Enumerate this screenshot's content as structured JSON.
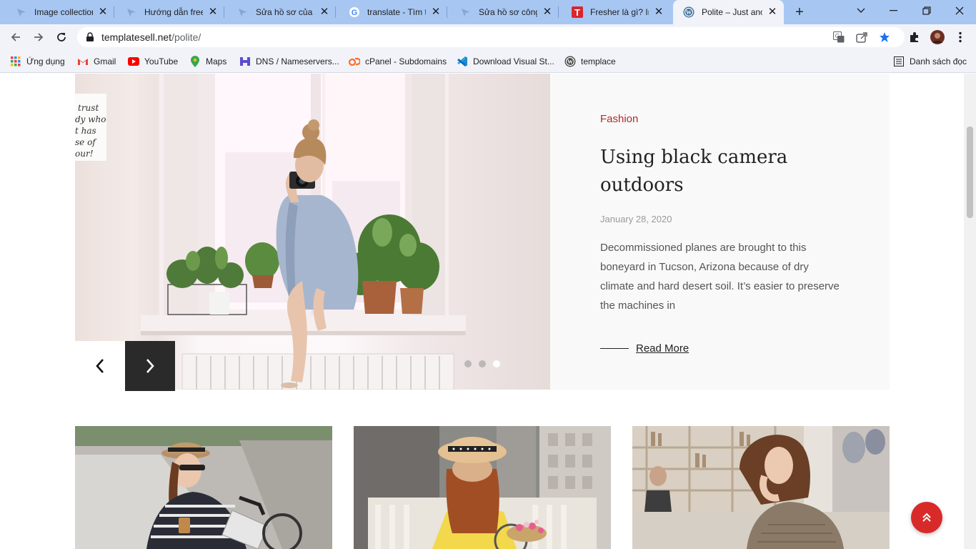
{
  "browser": {
    "tabs": [
      {
        "title": "Image collection",
        "favicon": "arrow-favicon",
        "active": false
      },
      {
        "title": "Hướng dẫn freela",
        "favicon": "arrow-favicon",
        "active": false
      },
      {
        "title": "Sửa hồ sơ của Trầ",
        "favicon": "arrow-favicon",
        "active": false
      },
      {
        "title": "translate - Tìm tr",
        "favicon": "google-favicon",
        "active": false
      },
      {
        "title": "Sửa hồ sơ công v",
        "favicon": "arrow-favicon",
        "active": false
      },
      {
        "title": "Fresher là gì? Inte",
        "favicon": "topdev-favicon",
        "active": false
      },
      {
        "title": "Polite – Just anot",
        "favicon": "wordpress-favicon",
        "active": true
      }
    ],
    "url": {
      "host": "templatesell.net",
      "path": "/polite/"
    },
    "bookmarks": [
      {
        "label": "Ứng dụng",
        "icon": "apps-grid-icon"
      },
      {
        "label": "Gmail",
        "icon": "gmail-icon"
      },
      {
        "label": "YouTube",
        "icon": "youtube-icon"
      },
      {
        "label": "Maps",
        "icon": "maps-icon"
      },
      {
        "label": "DNS / Nameservers...",
        "icon": "dns-icon"
      },
      {
        "label": "cPanel - Subdomains",
        "icon": "cpanel-icon"
      },
      {
        "label": "Download Visual St...",
        "icon": "vscode-icon"
      },
      {
        "label": "templace",
        "icon": "wordpress-icon"
      }
    ],
    "reading_list": "Danh sách đọc"
  },
  "hero": {
    "category": "Fashion",
    "title": "Using black camera outdoors",
    "date": "January 28, 2020",
    "excerpt": "Decommissioned planes are brought to this boneyard in Tucson, Arizona because of dry climate and hard desert soil. It’s easier to preserve the machines in",
    "read_more": "Read More",
    "slide_count": 3,
    "active_slide": 3
  },
  "colors": {
    "accent": "#b12a2a",
    "scroll_top_button": "#d92a2a",
    "tab_strip": "#a7c7f2"
  }
}
